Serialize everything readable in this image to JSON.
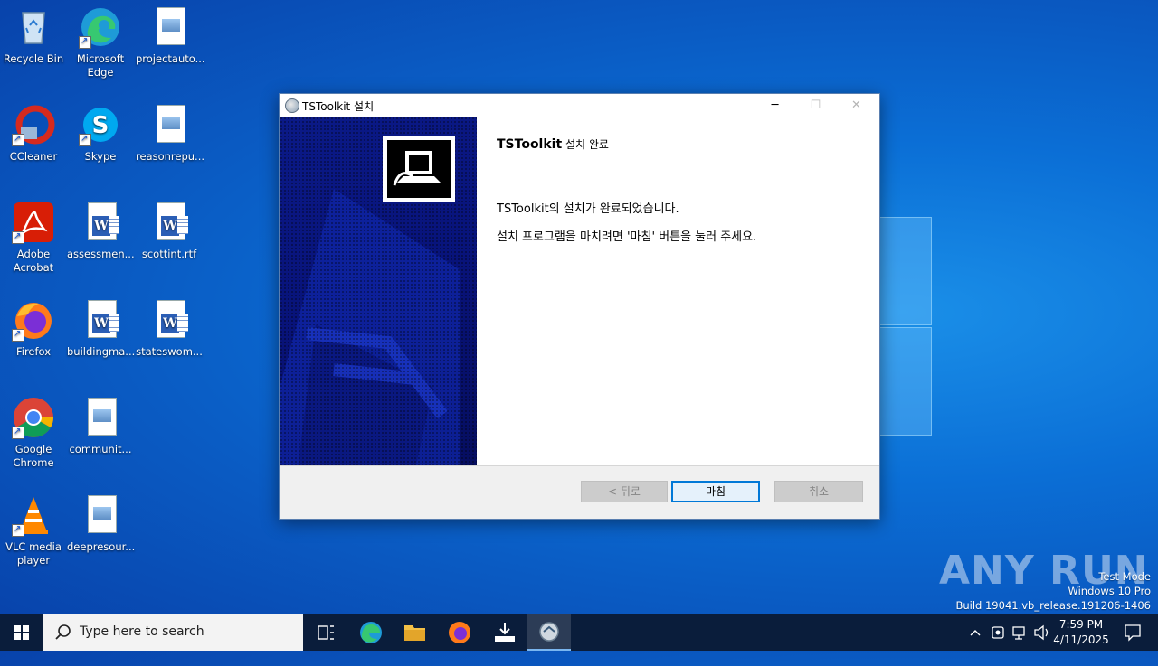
{
  "desktop": {
    "icons": [
      {
        "label": "Recycle Bin"
      },
      {
        "label": "Microsoft Edge"
      },
      {
        "label": "projectauto..."
      },
      {
        "label": "CCleaner"
      },
      {
        "label": "Skype"
      },
      {
        "label": "reasonrepu..."
      },
      {
        "label": "Adobe Acrobat"
      },
      {
        "label": "assessmen..."
      },
      {
        "label": "scottint.rtf"
      },
      {
        "label": "Firefox"
      },
      {
        "label": "buildingma..."
      },
      {
        "label": "stateswom..."
      },
      {
        "label": "Google Chrome"
      },
      {
        "label": "communit..."
      },
      {
        "label": "VLC media player"
      },
      {
        "label": "deepresour..."
      }
    ]
  },
  "dialog": {
    "title": "TSToolkit 설치",
    "heading_bold": "TSToolkit",
    "heading_rest": " 설치 완료",
    "message1": "TSToolkit의 설치가 완료되었습니다.",
    "message2": "설치 프로그램을 마치려면 '마침' 버튼을 눌러 주세요.",
    "back_label": "< 뒤로",
    "finish_label": "마침",
    "cancel_label": "취소"
  },
  "watermark": {
    "brand": "ANY RUN",
    "line1": "Test Mode",
    "line2": "Windows 10 Pro",
    "line3": "Build 19041.vb_release.191206-1406"
  },
  "taskbar": {
    "search_placeholder": "Type here to search",
    "time": "7:59 PM",
    "date": "4/11/2025"
  }
}
